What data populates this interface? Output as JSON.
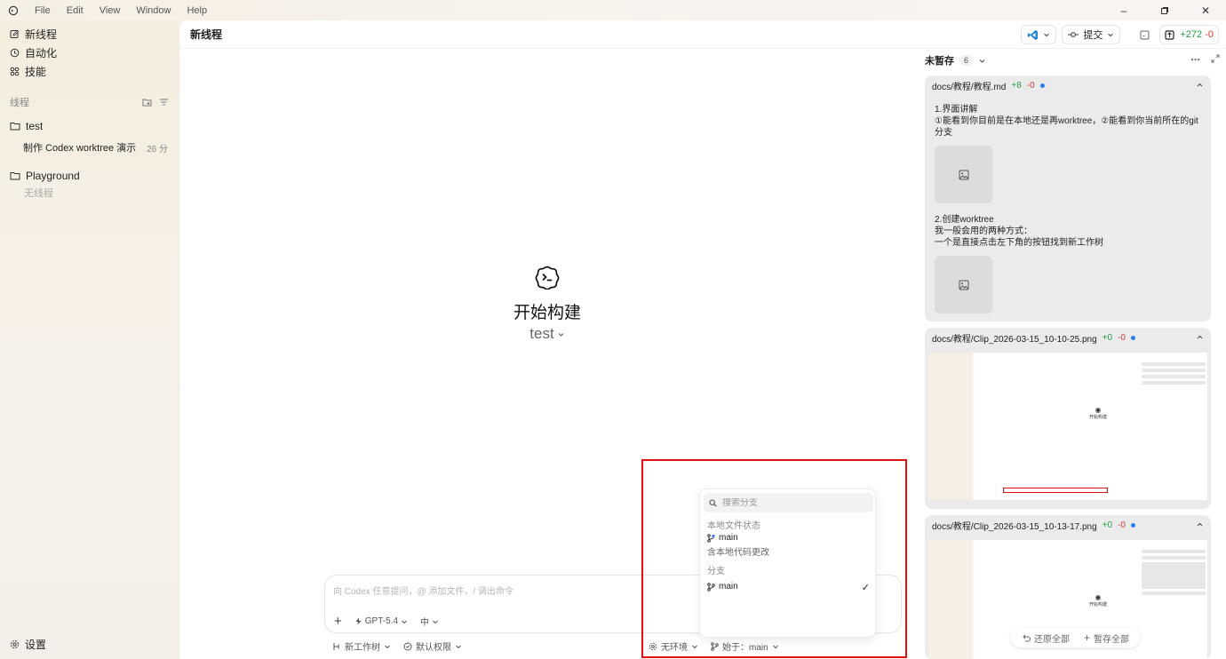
{
  "menu": {
    "items": [
      "File",
      "Edit",
      "View",
      "Window",
      "Help"
    ]
  },
  "sidebar": {
    "nav": [
      {
        "label": "新线程"
      },
      {
        "label": "自动化"
      },
      {
        "label": "技能"
      }
    ],
    "section_label": "线程",
    "folders": [
      {
        "name": "test",
        "threads": [
          {
            "title": "制作 Codex worktree 演示",
            "time": "26 分"
          }
        ]
      },
      {
        "name": "Playground",
        "empty_text": "无线程"
      }
    ],
    "settings_label": "设置"
  },
  "topbar": {
    "title": "新线程",
    "commit_label": "提交",
    "diff_plus": "+272",
    "diff_minus": "-0"
  },
  "hero": {
    "title": "开始构建",
    "project": "test"
  },
  "composer": {
    "placeholder": "向 Codex 任意提问，@ 添加文件，/ 调出命令",
    "model": "GPT-5.4",
    "effort": "中",
    "worktree_label": "新工作树",
    "permission_label": "默认权限",
    "env_label": "无环境",
    "branch_label": "始于：main"
  },
  "branch_dropdown": {
    "search_placeholder": "搜索分支",
    "group_local": "本地文件状态",
    "local_item": {
      "name": "main",
      "desc": "含本地代码更改"
    },
    "group_branches": "分支",
    "branches": [
      {
        "name": "main",
        "selected": true
      }
    ]
  },
  "right_panel": {
    "header": "未暂存",
    "count": "6",
    "cards": [
      {
        "path": "docs/教程/教程.md",
        "plus": "+8",
        "minus": "-0",
        "lines": [
          "1.界面讲解",
          "①能看到你目前是在本地还是再worktree，②能看到你当前所在的git分支",
          "2.创建worktree",
          "我一般会用的两种方式：",
          "一个是直接点击左下角的按钮找到新工作树"
        ]
      },
      {
        "path": "docs/教程/Clip_2026-03-15_10-10-25.png",
        "plus": "+0",
        "minus": "-0",
        "preview_text": "开始构建"
      },
      {
        "path": "docs/教程/Clip_2026-03-15_10-13-17.png",
        "plus": "+0",
        "minus": "-0",
        "preview_text": "开始构建"
      }
    ],
    "revert_all": "还原全部",
    "stage_all": "暂存全部"
  },
  "colors": {
    "accent_plus": "#22a046",
    "accent_minus": "#d83a3a",
    "highlight": "#e01010",
    "vscode_blue": "#1f86d8"
  }
}
